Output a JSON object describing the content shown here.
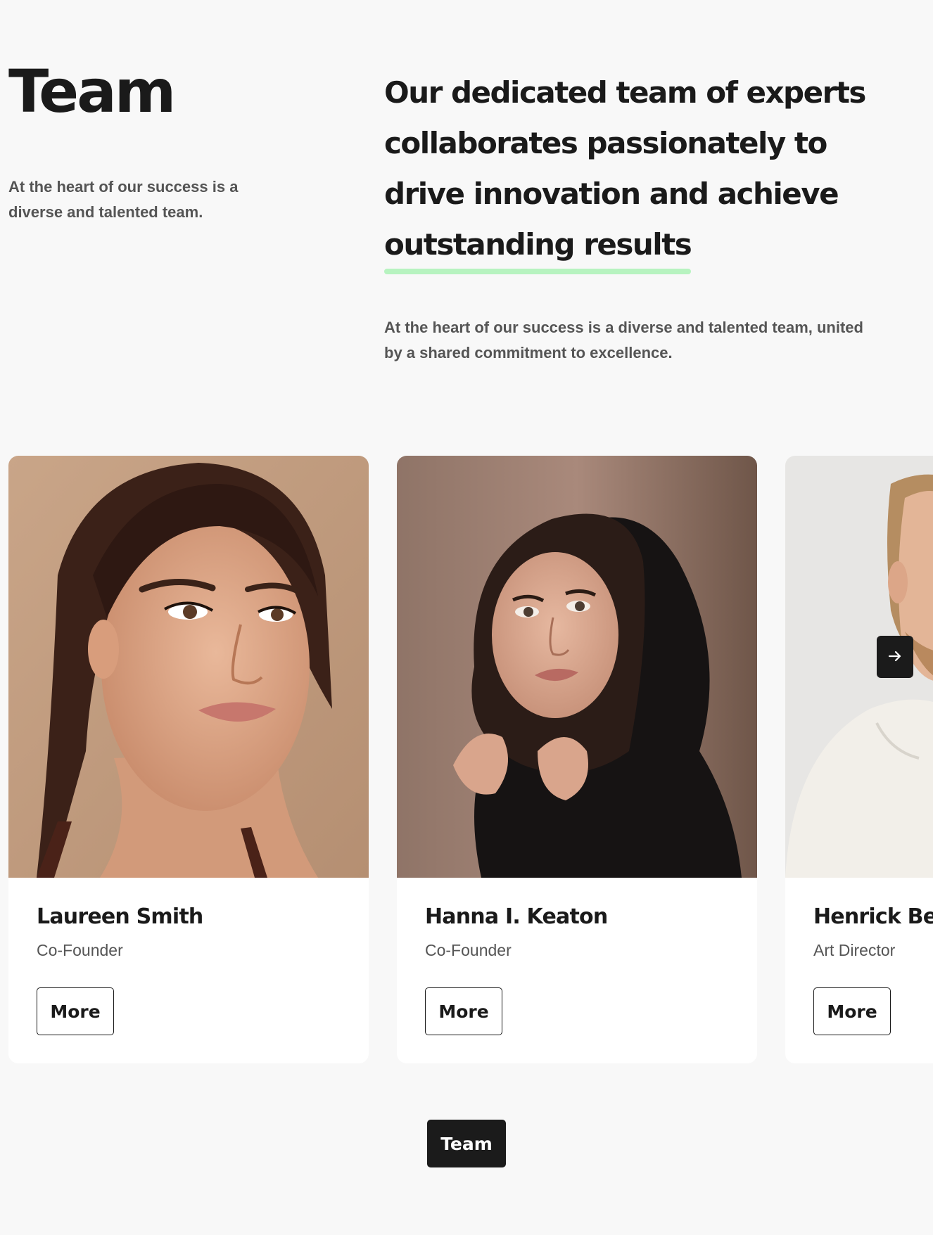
{
  "header": {
    "title": "Team",
    "intro": "At the heart of our success is a diverse and talented team.",
    "headline_main": "Our dedicated team of experts collaborates passionately to drive innovation and achieve ",
    "headline_highlight": "outstanding results",
    "subtext": "At the heart of our success is a diverse and talented team, united by a shared commitment to excellence."
  },
  "team": {
    "members": [
      {
        "name": "Laureen Smith",
        "role": "Co-Founder",
        "button_label": "More"
      },
      {
        "name": "Hanna I. Keaton",
        "role": "Co-Founder",
        "button_label": "More"
      },
      {
        "name": "Henrick Bee",
        "role": "Art Director",
        "button_label": "More"
      }
    ],
    "next_icon": "arrow-right-icon"
  },
  "footer": {
    "team_button_label": "Team"
  },
  "colors": {
    "background": "#f8f8f8",
    "card": "#ffffff",
    "dark": "#1b1b1b",
    "highlight_underline": "#b7f3c0"
  }
}
